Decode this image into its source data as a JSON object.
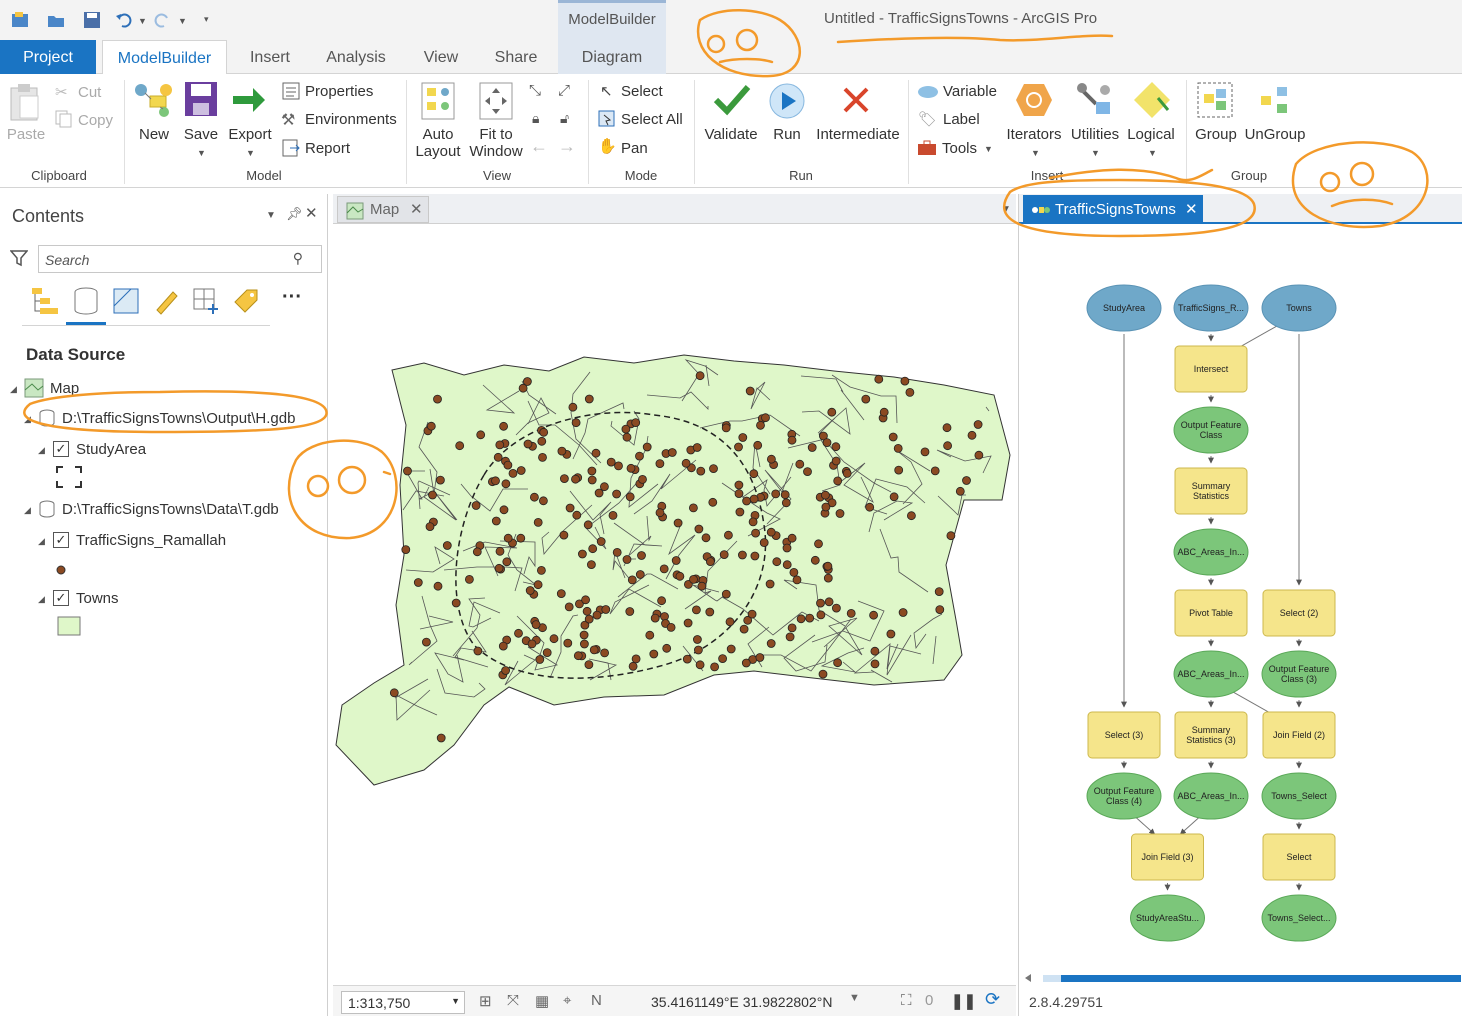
{
  "window": {
    "title": "Untitled - TrafficSignsTowns - ArcGIS Pro",
    "contextual_tab_group": "ModelBuilder"
  },
  "tabs": [
    {
      "label": "Project"
    },
    {
      "label": "ModelBuilder"
    },
    {
      "label": "Insert"
    },
    {
      "label": "Analysis"
    },
    {
      "label": "View"
    },
    {
      "label": "Share"
    },
    {
      "label": "Diagram"
    }
  ],
  "ribbon": {
    "clipboard": {
      "label": "Clipboard",
      "paste": "Paste",
      "cut": "Cut",
      "copy": "Copy"
    },
    "model": {
      "label": "Model",
      "new": "New",
      "save": "Save",
      "export": "Export",
      "properties": "Properties",
      "environments": "Environments",
      "report": "Report"
    },
    "view": {
      "label": "View",
      "auto_layout_1": "Auto",
      "auto_layout_2": "Layout",
      "fit_1": "Fit to",
      "fit_2": "Window"
    },
    "mode": {
      "label": "Mode",
      "select": "Select",
      "select_all": "Select All",
      "pan": "Pan"
    },
    "run": {
      "label": "Run",
      "validate": "Validate",
      "run": "Run",
      "intermediate": "Intermediate"
    },
    "insert": {
      "label": "Insert",
      "variable": "Variable",
      "label_btn": "Label",
      "tools": "Tools",
      "iterators": "Iterators",
      "utilities": "Utilities",
      "logical": "Logical"
    },
    "group": {
      "label": "Group",
      "group": "Group",
      "ungroup": "UnGroup"
    }
  },
  "contents": {
    "title": "Contents",
    "search_placeholder": "Search",
    "heading": "Data Source",
    "tree": {
      "map": "Map",
      "gdb1": "D:\\TrafficSignsTowns\\Output\\H.gdb",
      "study_area": "StudyArea",
      "gdb2": "D:\\TrafficSignsTowns\\Data\\T.gdb",
      "traffic_signs": "TrafficSigns_Ramallah",
      "towns": "Towns"
    }
  },
  "map_view": {
    "tab": "Map",
    "scale": "1:313,750",
    "coordinates": "35.4161149°E 31.9822802°N",
    "selected_count": "0",
    "colors": {
      "towns_fill": "#dff7c9",
      "points": "#8b4a22",
      "outline": "#333333"
    }
  },
  "modelbuilder": {
    "tab": "TrafficSignsTowns",
    "version": "2.8.4.29751",
    "colors": {
      "data_input": "#6fa8c9",
      "tool": "#f5e58b",
      "output": "#7cc67a"
    },
    "nodes": [
      {
        "id": "n1",
        "kind": "data",
        "lines": [
          "StudyArea"
        ]
      },
      {
        "id": "n2",
        "kind": "data",
        "lines": [
          "TrafficSigns_R..."
        ]
      },
      {
        "id": "n3",
        "kind": "data",
        "lines": [
          "Towns"
        ]
      },
      {
        "id": "n4",
        "kind": "tool",
        "lines": [
          "Intersect"
        ]
      },
      {
        "id": "n5",
        "kind": "out",
        "lines": [
          "Output Feature",
          "Class"
        ]
      },
      {
        "id": "n6",
        "kind": "tool",
        "lines": [
          "Summary",
          "Statistics"
        ]
      },
      {
        "id": "n7",
        "kind": "out",
        "lines": [
          "ABC_Areas_In..."
        ]
      },
      {
        "id": "n8",
        "kind": "tool",
        "lines": [
          "Pivot Table"
        ]
      },
      {
        "id": "n9",
        "kind": "tool",
        "lines": [
          "Select (2)"
        ]
      },
      {
        "id": "n10",
        "kind": "out",
        "lines": [
          "ABC_Areas_In..."
        ]
      },
      {
        "id": "n11",
        "kind": "out",
        "lines": [
          "Output Feature",
          "Class (3)"
        ]
      },
      {
        "id": "n12",
        "kind": "tool",
        "lines": [
          "Select (3)"
        ]
      },
      {
        "id": "n13",
        "kind": "tool",
        "lines": [
          "Summary",
          "Statistics (3)"
        ]
      },
      {
        "id": "n14",
        "kind": "tool",
        "lines": [
          "Join Field (2)"
        ]
      },
      {
        "id": "n15",
        "kind": "out",
        "lines": [
          "Output Feature",
          "Class (4)"
        ]
      },
      {
        "id": "n16",
        "kind": "out",
        "lines": [
          "ABC_Areas_In..."
        ]
      },
      {
        "id": "n17",
        "kind": "out",
        "lines": [
          "Towns_Select"
        ]
      },
      {
        "id": "n18",
        "kind": "tool",
        "lines": [
          "Join Field (3)"
        ]
      },
      {
        "id": "n19",
        "kind": "tool",
        "lines": [
          "Select"
        ]
      },
      {
        "id": "n20",
        "kind": "out",
        "lines": [
          "StudyAreaStu..."
        ]
      },
      {
        "id": "n21",
        "kind": "out",
        "lines": [
          "Towns_Select..."
        ]
      }
    ],
    "edges": [
      [
        "n2",
        "n4"
      ],
      [
        "n3",
        "n4"
      ],
      [
        "n4",
        "n5"
      ],
      [
        "n5",
        "n6"
      ],
      [
        "n6",
        "n7"
      ],
      [
        "n7",
        "n8"
      ],
      [
        "n8",
        "n10"
      ],
      [
        "n10",
        "n14"
      ],
      [
        "n1",
        "n12"
      ],
      [
        "n12",
        "n15"
      ],
      [
        "n15",
        "n18"
      ],
      [
        "n10",
        "n13"
      ],
      [
        "n13",
        "n16"
      ],
      [
        "n16",
        "n18"
      ],
      [
        "n18",
        "n20"
      ],
      [
        "n3",
        "n9"
      ],
      [
        "n9",
        "n11"
      ],
      [
        "n11",
        "n14"
      ],
      [
        "n14",
        "n17"
      ],
      [
        "n17",
        "n19"
      ],
      [
        "n19",
        "n21"
      ]
    ]
  }
}
